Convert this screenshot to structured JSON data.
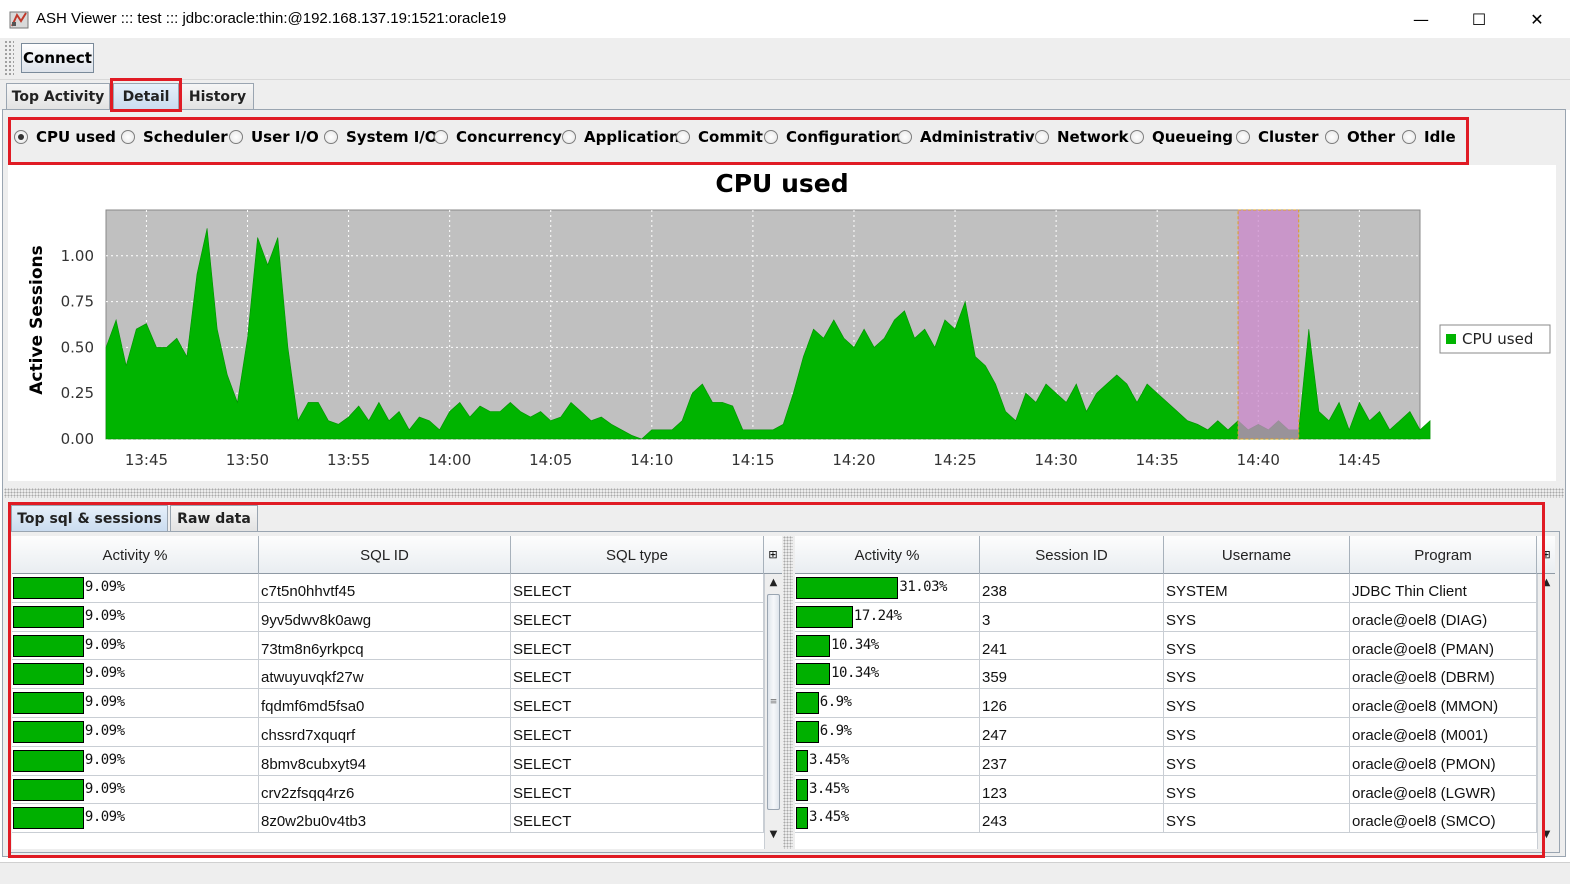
{
  "window": {
    "title": "ASH Viewer ::: test ::: jdbc:oracle:thin:@192.168.137.19:1521:oracle19",
    "minimize_glyph": "—",
    "maximize_glyph": "☐",
    "close_glyph": "✕"
  },
  "toolbar": {
    "connect_label": "Connect"
  },
  "main_tabs": [
    {
      "label": "Top Activity"
    },
    {
      "label": "Detail",
      "selected": true
    },
    {
      "label": "History"
    }
  ],
  "wait_classes": [
    {
      "label": "CPU used",
      "selected": true
    },
    {
      "label": "Scheduler"
    },
    {
      "label": "User I/O"
    },
    {
      "label": "System I/O"
    },
    {
      "label": "Concurrency"
    },
    {
      "label": "Application"
    },
    {
      "label": "Commit"
    },
    {
      "label": "Configuration"
    },
    {
      "label": "Administrative"
    },
    {
      "label": "Network"
    },
    {
      "label": "Queueing"
    },
    {
      "label": "Cluster"
    },
    {
      "label": "Other"
    },
    {
      "label": "Idle"
    }
  ],
  "chart_data": {
    "type": "area",
    "title": "CPU used",
    "xlabel": "",
    "ylabel": "Active Sessions",
    "x_ticks": [
      "13:45",
      "13:50",
      "13:55",
      "14:00",
      "14:05",
      "14:10",
      "14:15",
      "14:20",
      "14:25",
      "14:30",
      "14:35",
      "14:40",
      "14:45"
    ],
    "y_ticks": [
      "0.00",
      "0.25",
      "0.50",
      "0.75",
      "1.00"
    ],
    "xlim": [
      "13:43",
      "14:48"
    ],
    "ylim": [
      0,
      1.25
    ],
    "grid": true,
    "legend_position": "right",
    "series": [
      {
        "name": "CPU used",
        "color": "#00b400",
        "x_start": "13:43",
        "x_step_minutes": 0.5,
        "values": [
          0.5,
          0.65,
          0.4,
          0.6,
          0.63,
          0.5,
          0.5,
          0.55,
          0.45,
          0.9,
          1.15,
          0.6,
          0.35,
          0.2,
          0.55,
          1.1,
          0.95,
          1.1,
          0.5,
          0.1,
          0.2,
          0.2,
          0.1,
          0.08,
          0.12,
          0.18,
          0.1,
          0.2,
          0.1,
          0.15,
          0.05,
          0.12,
          0.1,
          0.05,
          0.15,
          0.2,
          0.12,
          0.18,
          0.15,
          0.15,
          0.2,
          0.15,
          0.12,
          0.15,
          0.1,
          0.12,
          0.2,
          0.15,
          0.1,
          0.12,
          0.08,
          0.05,
          0.02,
          0.0,
          0.05,
          0.05,
          0.05,
          0.1,
          0.25,
          0.3,
          0.2,
          0.2,
          0.18,
          0.05,
          0.05,
          0.05,
          0.05,
          0.08,
          0.25,
          0.45,
          0.6,
          0.55,
          0.65,
          0.55,
          0.5,
          0.6,
          0.5,
          0.55,
          0.65,
          0.7,
          0.55,
          0.6,
          0.5,
          0.65,
          0.6,
          0.75,
          0.45,
          0.4,
          0.3,
          0.15,
          0.1,
          0.25,
          0.2,
          0.3,
          0.25,
          0.2,
          0.3,
          0.15,
          0.25,
          0.3,
          0.35,
          0.3,
          0.2,
          0.3,
          0.25,
          0.2,
          0.15,
          0.1,
          0.08,
          0.05,
          0.1,
          0.05,
          0.1,
          0.05,
          0.08,
          0.05,
          0.1,
          0.05,
          0.05,
          0.6,
          0.15,
          0.1,
          0.2,
          0.05,
          0.2,
          0.1,
          0.15,
          0.05,
          0.1,
          0.15,
          0.05,
          0.1
        ]
      }
    ],
    "selection": {
      "from": "14:39",
      "to": "14:42",
      "color": "#cc88cc"
    }
  },
  "bottom_tabs": [
    {
      "label": "Top sql & sessions",
      "selected": true
    },
    {
      "label": "Raw data"
    }
  ],
  "sql_table": {
    "columns": [
      "Activity %",
      "SQL ID",
      "SQL type"
    ],
    "rows": [
      {
        "activity": 9.09,
        "activity_label": "9.09%",
        "sql_id": "c7t5n0hhvtf45",
        "sql_type": "SELECT"
      },
      {
        "activity": 9.09,
        "activity_label": "9.09%",
        "sql_id": "9yv5dwv8k0awg",
        "sql_type": "SELECT"
      },
      {
        "activity": 9.09,
        "activity_label": "9.09%",
        "sql_id": "73tm8n6yrkpcq",
        "sql_type": "SELECT"
      },
      {
        "activity": 9.09,
        "activity_label": "9.09%",
        "sql_id": "atwuyuvqkf27w",
        "sql_type": "SELECT"
      },
      {
        "activity": 9.09,
        "activity_label": "9.09%",
        "sql_id": "fqdmf6md5fsa0",
        "sql_type": "SELECT"
      },
      {
        "activity": 9.09,
        "activity_label": "9.09%",
        "sql_id": "chssrd7xquqrf",
        "sql_type": "SELECT"
      },
      {
        "activity": 9.09,
        "activity_label": "9.09%",
        "sql_id": "8bmv8cubxyt94",
        "sql_type": "SELECT"
      },
      {
        "activity": 9.09,
        "activity_label": "9.09%",
        "sql_id": "crv2zfsqq4rz6",
        "sql_type": "SELECT"
      },
      {
        "activity": 9.09,
        "activity_label": "9.09%",
        "sql_id": "8z0w2bu0v4tb3",
        "sql_type": "SELECT"
      }
    ]
  },
  "session_table": {
    "columns": [
      "Activity %",
      "Session ID",
      "Username",
      "Program"
    ],
    "rows": [
      {
        "activity": 31.03,
        "activity_label": "31.03%",
        "session_id": "238",
        "username": "SYSTEM",
        "program": "JDBC Thin Client"
      },
      {
        "activity": 17.24,
        "activity_label": "17.24%",
        "session_id": "3",
        "username": "SYS",
        "program": "oracle@oel8 (DIAG)"
      },
      {
        "activity": 10.34,
        "activity_label": "10.34%",
        "session_id": "241",
        "username": "SYS",
        "program": "oracle@oel8 (PMAN)"
      },
      {
        "activity": 10.34,
        "activity_label": "10.34%",
        "session_id": "359",
        "username": "SYS",
        "program": "oracle@oel8 (DBRM)"
      },
      {
        "activity": 6.9,
        "activity_label": "6.9%",
        "session_id": "126",
        "username": "SYS",
        "program": "oracle@oel8 (MMON)"
      },
      {
        "activity": 6.9,
        "activity_label": "6.9%",
        "session_id": "247",
        "username": "SYS",
        "program": "oracle@oel8 (M001)"
      },
      {
        "activity": 3.45,
        "activity_label": "3.45%",
        "session_id": "237",
        "username": "SYS",
        "program": "oracle@oel8 (PMON)"
      },
      {
        "activity": 3.45,
        "activity_label": "3.45%",
        "session_id": "123",
        "username": "SYS",
        "program": "oracle@oel8 (LGWR)"
      },
      {
        "activity": 3.45,
        "activity_label": "3.45%",
        "session_id": "243",
        "username": "SYS",
        "program": "oracle@oel8 (SMCO)"
      }
    ]
  },
  "icons": {
    "scroll_up": "▲",
    "scroll_down": "▼",
    "column_control": "⊞",
    "thumb_grip": "≡"
  },
  "colors": {
    "bar_fill": "#00b000",
    "plot_background": "#c0c0c0",
    "highlight_box": "#e01b24",
    "selected_tab": "#c9dbef"
  }
}
